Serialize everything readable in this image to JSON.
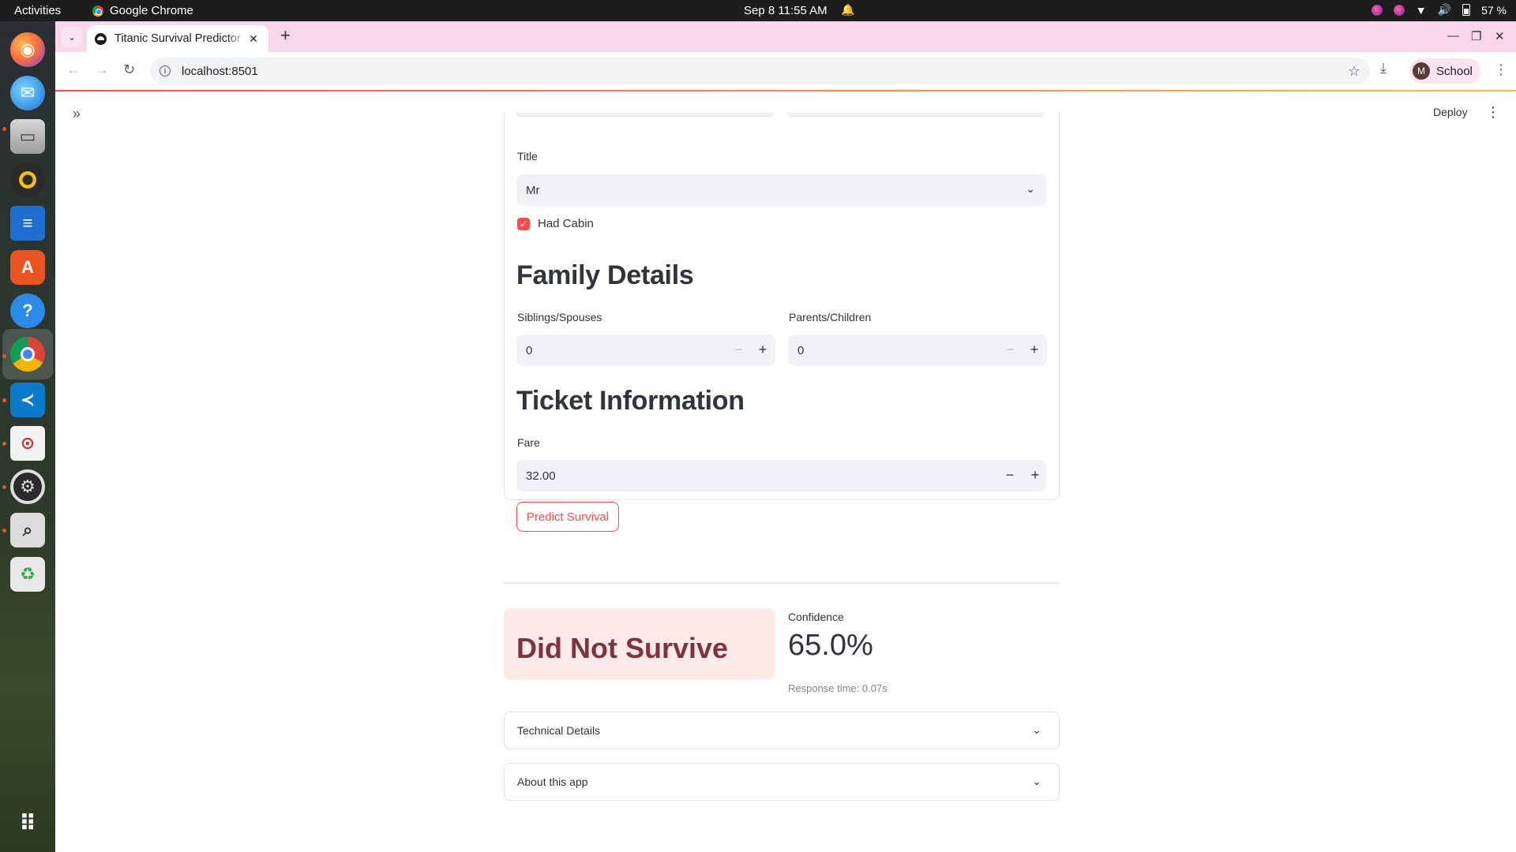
{
  "system_bar": {
    "activities": "Activities",
    "app_name": "Google Chrome",
    "clock": "Sep 8  11:55 AM",
    "battery": "57 %"
  },
  "dock": {
    "items": [
      "firefox-icon",
      "thunderbird-icon",
      "files-icon",
      "rhythmbox-icon",
      "writer-icon",
      "app-center-icon",
      "help-icon",
      "chrome-icon",
      "vscode-icon",
      "document-viewer-icon",
      "settings-icon",
      "search-tool-icon",
      "trash-icon",
      "app-grid-icon"
    ]
  },
  "browser": {
    "tab_title": "Titanic Survival Predictor",
    "url": "localhost:8501",
    "profile_initial": "M",
    "profile_name": "School"
  },
  "app": {
    "deploy_label": "Deploy",
    "title_field": {
      "label": "Title",
      "value": "Mr"
    },
    "had_cabin": {
      "label": "Had Cabin",
      "checked": true
    },
    "family_heading": "Family Details",
    "siblings": {
      "label": "Siblings/Spouses",
      "value": "0"
    },
    "parents": {
      "label": "Parents/Children",
      "value": "0"
    },
    "ticket_heading": "Ticket Information",
    "fare": {
      "label": "Fare",
      "value": "32.00"
    },
    "predict_label": "Predict Survival",
    "result": "Did Not Survive",
    "confidence_label": "Confidence",
    "confidence_value": "65.0%",
    "response_time": "Response time: 0.07s",
    "expanders": [
      "Technical Details",
      "About this app"
    ],
    "colors": {
      "primary": "#ff4b4b",
      "error_bg": "#ffeaea",
      "error_text": "#7d353b"
    }
  }
}
